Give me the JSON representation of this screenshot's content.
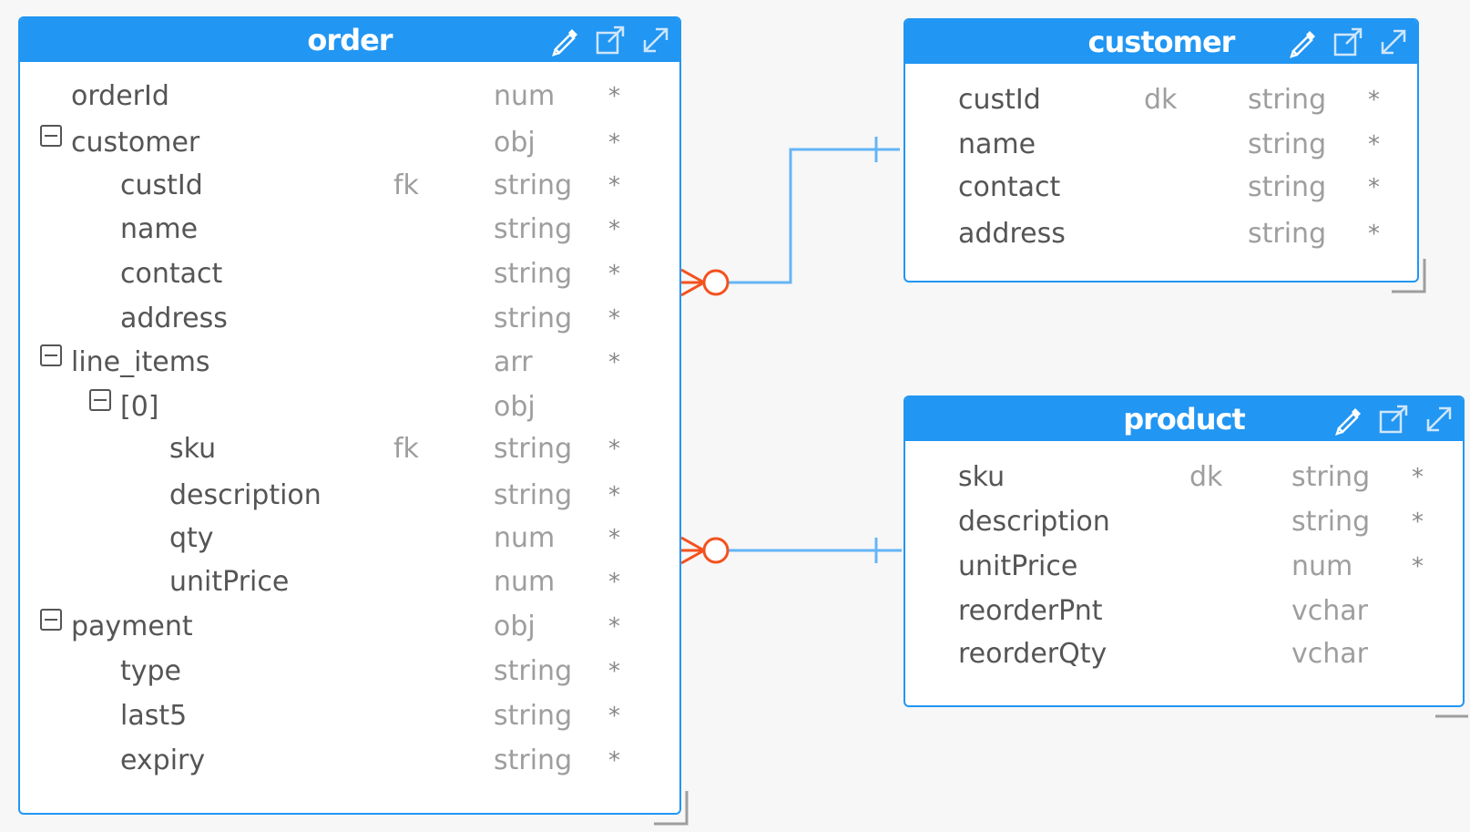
{
  "entities": {
    "order": {
      "title": "order",
      "rows": [
        {
          "name": "orderId",
          "key": "",
          "type": "num",
          "req": "*"
        },
        {
          "name": "customer",
          "key": "",
          "type": "obj",
          "req": "*"
        },
        {
          "name": "custId",
          "key": "fk",
          "type": "string",
          "req": "*"
        },
        {
          "name": "name",
          "key": "",
          "type": "string",
          "req": "*"
        },
        {
          "name": "contact",
          "key": "",
          "type": "string",
          "req": "*"
        },
        {
          "name": "address",
          "key": "",
          "type": "string",
          "req": "*"
        },
        {
          "name": "line_items",
          "key": "",
          "type": "arr",
          "req": "*"
        },
        {
          "name": "[0]",
          "key": "",
          "type": "obj",
          "req": ""
        },
        {
          "name": "sku",
          "key": "fk",
          "type": "string",
          "req": "*"
        },
        {
          "name": "description",
          "key": "",
          "type": "string",
          "req": "*"
        },
        {
          "name": "qty",
          "key": "",
          "type": "num",
          "req": "*"
        },
        {
          "name": "unitPrice",
          "key": "",
          "type": "num",
          "req": "*"
        },
        {
          "name": "payment",
          "key": "",
          "type": "obj",
          "req": "*"
        },
        {
          "name": "type",
          "key": "",
          "type": "string",
          "req": "*"
        },
        {
          "name": "last5",
          "key": "",
          "type": "string",
          "req": "*"
        },
        {
          "name": "expiry",
          "key": "",
          "type": "string",
          "req": "*"
        }
      ]
    },
    "customer": {
      "title": "customer",
      "rows": [
        {
          "name": "custId",
          "key": "dk",
          "type": "string",
          "req": "*"
        },
        {
          "name": "name",
          "key": "",
          "type": "string",
          "req": "*"
        },
        {
          "name": "contact",
          "key": "",
          "type": "string",
          "req": "*"
        },
        {
          "name": "address",
          "key": "",
          "type": "string",
          "req": "*"
        }
      ]
    },
    "product": {
      "title": "product",
      "rows": [
        {
          "name": "sku",
          "key": "dk",
          "type": "string",
          "req": "*"
        },
        {
          "name": "description",
          "key": "",
          "type": "string",
          "req": "*"
        },
        {
          "name": "unitPrice",
          "key": "",
          "type": "num",
          "req": "*"
        },
        {
          "name": "reorderPnt",
          "key": "",
          "type": "vchar",
          "req": ""
        },
        {
          "name": "reorderQty",
          "key": "",
          "type": "vchar",
          "req": ""
        }
      ]
    }
  },
  "icons": [
    "edit-pencil-icon",
    "open-external-icon",
    "expand-icon"
  ],
  "colors": {
    "header": "#2196f3",
    "relationship_line": "#64b5f6",
    "crowsfoot": "#f4511e",
    "text": "#555555",
    "muted": "#9e9e9e"
  }
}
